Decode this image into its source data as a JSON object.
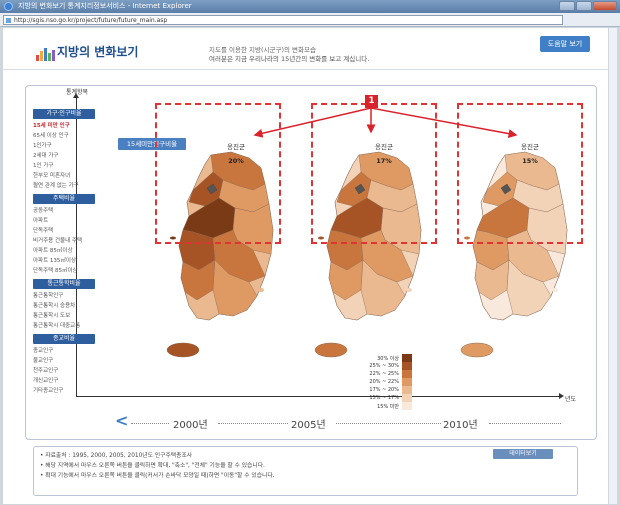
{
  "window": {
    "title": "지방의 변화보기 통계지리정보서비스 - Internet Explorer",
    "url": "http://sgis.nso.go.kr/project/future/future_main.asp"
  },
  "header": {
    "logo_text": "지방의 변화보기",
    "description_line1": "지도를 이용한 지방(시군구)의 변화모습",
    "description_line2": "여러분은 지금 우리나라의 15년간의 변화를 보고 계십니다.",
    "help_button": "도움말 보기"
  },
  "chart_area": {
    "y_axis_label": "통계항목",
    "x_axis_label": "년도",
    "indicator_label": "15세미만인구비율",
    "callout_number": "1"
  },
  "sidebar": {
    "categories": [
      {
        "title": "가구·인구비율",
        "items": [
          "15세 미만 인구",
          "65세 이상 인구",
          "1인가구",
          "2세대 가구",
          "1인 가구",
          "한부모 미혼자녀",
          "혈연 관계 없는 가구"
        ]
      },
      {
        "title": "주택비율",
        "items": [
          "공동주택",
          "아파트",
          "단독주택",
          "비거주용 건물내 주택",
          "아파트 85㎡이상",
          "아파트 135㎡이상",
          "단독주택 85㎡이상"
        ]
      },
      {
        "title": "통근통학비율",
        "items": [
          "통근통학인구",
          "통근통학시 승용차",
          "통근통학시 도보",
          "통근통학시 대중교통"
        ]
      },
      {
        "title": "종교비율",
        "items": [
          "종교인구",
          "불교인구",
          "천주교인구",
          "개신교인구",
          "기타종교인구"
        ]
      }
    ],
    "active_item": "15세 미만 인구"
  },
  "maps": [
    {
      "year": "2000년",
      "county": "옹진군",
      "value": "20%"
    },
    {
      "year": "2005년",
      "county": "옹진군",
      "value": "17%"
    },
    {
      "year": "2010년",
      "county": "옹진군",
      "value": "15%"
    }
  ],
  "legend": [
    {
      "label": "30% 이상",
      "color": "#7a3a16"
    },
    {
      "label": "25% ~ 30%",
      "color": "#a65426"
    },
    {
      "label": "22% ~ 25%",
      "color": "#c9763e"
    },
    {
      "label": "20% ~ 22%",
      "color": "#df9a63"
    },
    {
      "label": "17% ~ 20%",
      "color": "#ebb990"
    },
    {
      "label": "15% ~ 17%",
      "color": "#f3d3b8"
    },
    {
      "label": "15% 미만",
      "color": "#f9e9dc"
    }
  ],
  "notes": [
    "• 자료출처 : 1995, 2000, 2005, 2010년도 인구주택총조사",
    "• 해당 지역에서 마우스 오른쪽 버튼을 클릭하면 확대, \"축소\", \"전체\" 기능을 할 수 있습니다.",
    "• 확대 기능에서 마우스 오른쪽 버튼을 클릭(커서가 손바닥 모양일 때)하면 \"이동\"할 수 있습니다."
  ],
  "data_button": "데이터보기",
  "colors": {
    "accent": "#3f7fc7",
    "header_blue": "#2f5e9e",
    "dashed_red": "#e03434"
  }
}
